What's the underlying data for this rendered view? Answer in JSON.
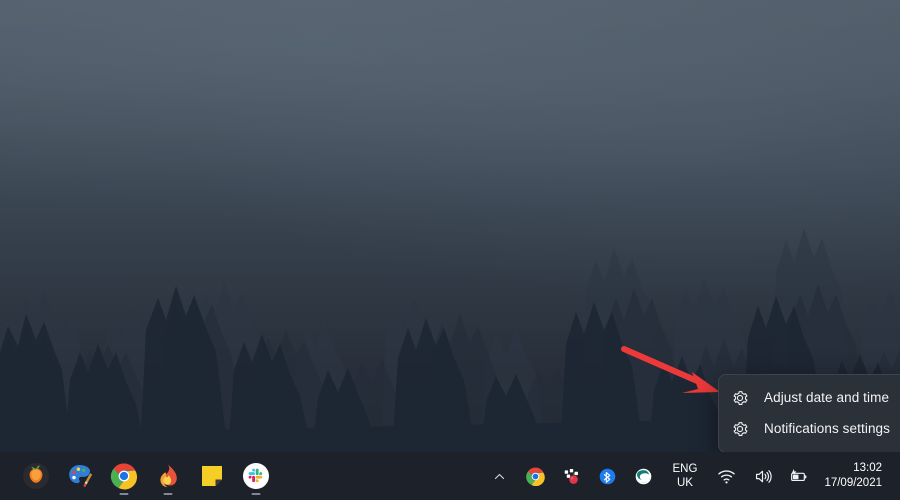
{
  "desktop": {
    "wallpaper_name": "misty-pine-forest-wallpaper",
    "colors": {
      "sky_top": "#4e5a67",
      "sky_bottom": "#222833",
      "tree_silhouette": "#1f2733",
      "taskbar": "#1d212a",
      "menu_background": "#2b3139",
      "menu_text": "#f2f4f7",
      "annotation_red": "#ec3a3a",
      "tray_text": "#ffffff"
    }
  },
  "annotation": {
    "arrow_name": "red-pointer-arrow",
    "color": "#ec3a3a",
    "points_to": "Adjust date and time"
  },
  "context_menu": {
    "name": "clock-context-menu",
    "items": [
      {
        "label": "Adjust date and time",
        "icon": "gear-icon"
      },
      {
        "label": "Notifications settings",
        "icon": "gear-icon"
      }
    ]
  },
  "taskbar": {
    "apps": [
      {
        "name": "fl-studio",
        "label": "FL Studio",
        "running": false
      },
      {
        "name": "paint",
        "label": "Paint",
        "running": false
      },
      {
        "name": "google-chrome",
        "label": "Google Chrome",
        "running": true
      },
      {
        "name": "blaze-app",
        "label": "Blaze",
        "running": true
      },
      {
        "name": "sticky-notes",
        "label": "Sticky Notes",
        "running": false
      },
      {
        "name": "slack",
        "label": "Slack",
        "running": true
      }
    ],
    "tray": {
      "overflow_label": "Show hidden icons",
      "icons": [
        {
          "name": "chevron-up-icon",
          "label": "Show hidden icons"
        },
        {
          "name": "chrome-tray-icon",
          "label": "Google Chrome"
        },
        {
          "name": "raspberry-tray-icon",
          "label": "Background app"
        },
        {
          "name": "bluetooth-icon",
          "label": "Bluetooth"
        },
        {
          "name": "edge-icon",
          "label": "Microsoft Edge"
        }
      ],
      "language": {
        "line1": "ENG",
        "line2": "UK"
      },
      "status_icons": [
        {
          "name": "wifi-icon",
          "label": "Network"
        },
        {
          "name": "speaker-icon",
          "label": "Volume"
        },
        {
          "name": "battery-charging-icon",
          "label": "Battery charging"
        }
      ]
    },
    "clock": {
      "time": "13:02",
      "date": "17/09/2021"
    }
  }
}
